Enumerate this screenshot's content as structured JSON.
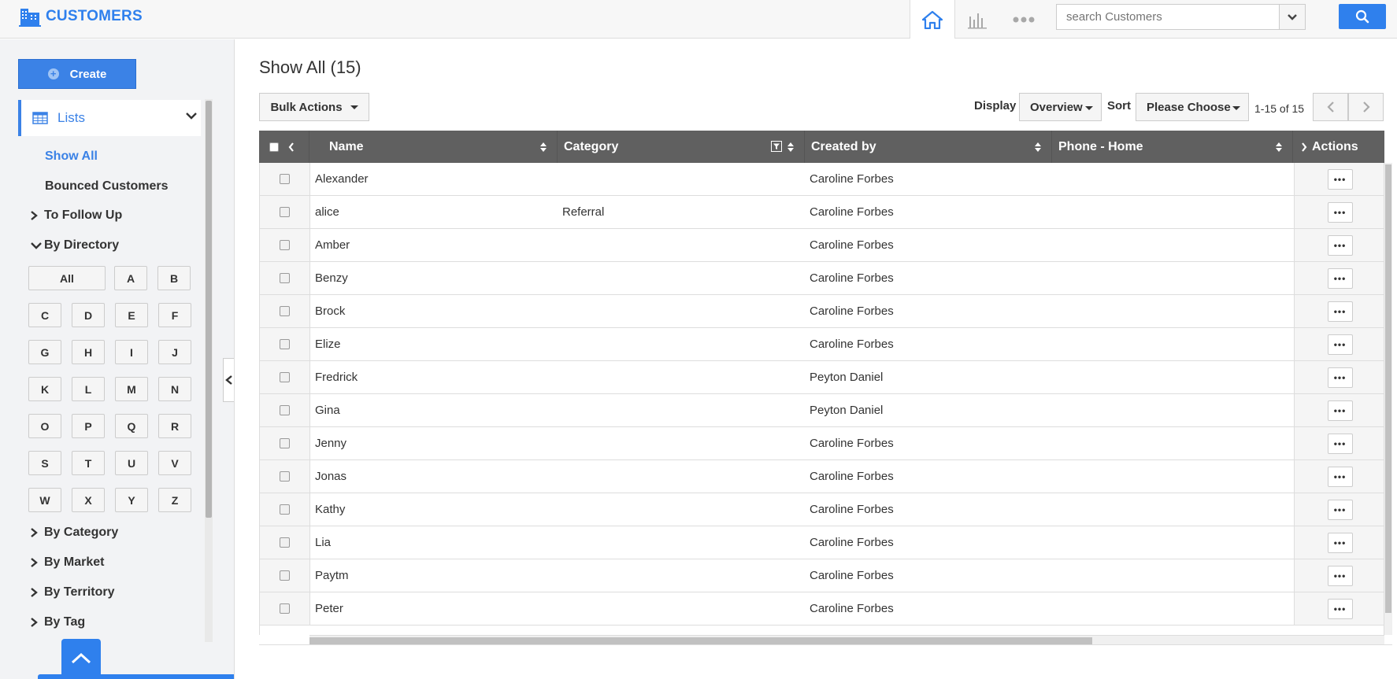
{
  "app": {
    "title": "CUSTOMERS",
    "brand_color": "#2f80ed",
    "logo_icon": "building-icon"
  },
  "header": {
    "nav": [
      {
        "name": "home-icon",
        "active": true
      },
      {
        "name": "bar-chart-icon",
        "active": false
      },
      {
        "name": "more-dots-icon",
        "active": false
      }
    ],
    "search_placeholder": "search Customers"
  },
  "sidebar": {
    "create_label": "Create",
    "lists_label": "Lists",
    "show_all": "Show All",
    "bounced": "Bounced Customers",
    "to_follow_up": "To Follow Up",
    "by_directory": "By Directory",
    "letters": [
      "All",
      "A",
      "B",
      "C",
      "D",
      "E",
      "F",
      "G",
      "H",
      "I",
      "J",
      "K",
      "L",
      "M",
      "N",
      "O",
      "P",
      "Q",
      "R",
      "S",
      "T",
      "U",
      "V",
      "W",
      "X",
      "Y",
      "Z"
    ],
    "groups": [
      "By Category",
      "By Market",
      "By Territory",
      "By Tag"
    ]
  },
  "main": {
    "title": "Show All (15)",
    "bulk_actions": "Bulk Actions",
    "display_label": "Display",
    "display_value": "Overview",
    "sort_label": "Sort",
    "sort_value": "Please Choose",
    "page_info": "1-15 of 15"
  },
  "table": {
    "columns": [
      "Name",
      "Category",
      "Created by",
      "Phone - Home",
      "Actions"
    ],
    "rows": [
      {
        "name": "Alexander",
        "category": "",
        "created_by": "Caroline Forbes",
        "phone": ""
      },
      {
        "name": "alice",
        "category": "Referral",
        "created_by": "Caroline Forbes",
        "phone": ""
      },
      {
        "name": "Amber",
        "category": "",
        "created_by": "Caroline Forbes",
        "phone": ""
      },
      {
        "name": "Benzy",
        "category": "",
        "created_by": "Caroline Forbes",
        "phone": ""
      },
      {
        "name": "Brock",
        "category": "",
        "created_by": "Caroline Forbes",
        "phone": ""
      },
      {
        "name": "Elize",
        "category": "",
        "created_by": "Caroline Forbes",
        "phone": ""
      },
      {
        "name": "Fredrick",
        "category": "",
        "created_by": "Peyton Daniel",
        "phone": ""
      },
      {
        "name": "Gina",
        "category": "",
        "created_by": "Peyton Daniel",
        "phone": ""
      },
      {
        "name": "Jenny",
        "category": "",
        "created_by": "Caroline Forbes",
        "phone": ""
      },
      {
        "name": "Jonas",
        "category": "",
        "created_by": "Caroline Forbes",
        "phone": ""
      },
      {
        "name": "Kathy",
        "category": "",
        "created_by": "Caroline Forbes",
        "phone": ""
      },
      {
        "name": "Lia",
        "category": "",
        "created_by": "Caroline Forbes",
        "phone": ""
      },
      {
        "name": "Paytm",
        "category": "",
        "created_by": "Caroline Forbes",
        "phone": ""
      },
      {
        "name": "Peter",
        "category": "",
        "created_by": "Caroline Forbes",
        "phone": ""
      }
    ],
    "actions_glyph": "•••"
  }
}
